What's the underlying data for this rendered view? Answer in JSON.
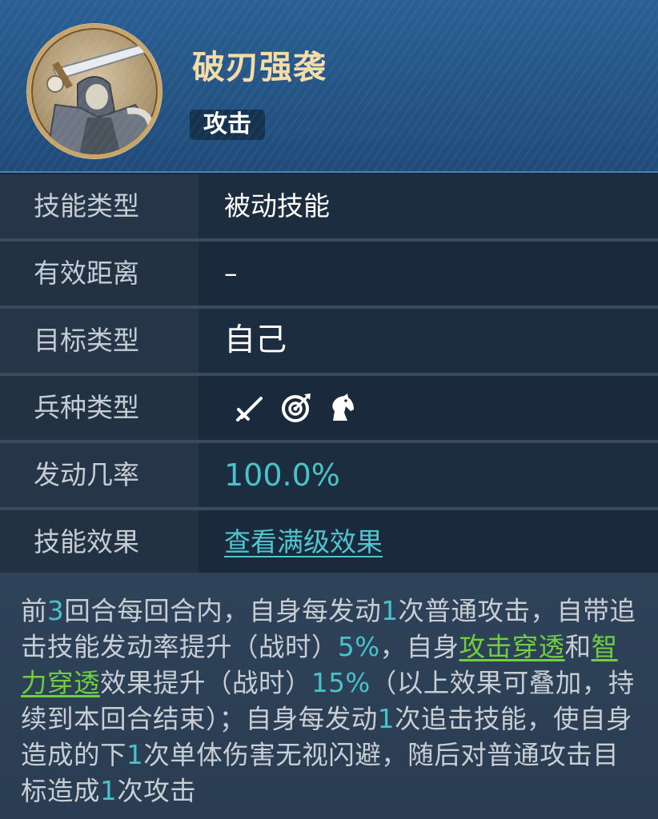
{
  "skill": {
    "name": "破刃强袭",
    "tag": "攻击"
  },
  "rows": [
    {
      "label": "技能类型",
      "value": "被动技能"
    },
    {
      "label": "有效距离",
      "value": "–"
    },
    {
      "label": "目标类型",
      "value": "自己"
    },
    {
      "label": "兵种类型",
      "icons": [
        "sword-icon",
        "target-icon",
        "horse-icon"
      ]
    },
    {
      "label": "发动几率",
      "value": "100.0%"
    },
    {
      "label": "技能效果",
      "value": "查看满级效果"
    }
  ],
  "description": {
    "p01": "前",
    "p02": "3",
    "p03": "回合每回合内，自身每发动",
    "p04": "1",
    "p05": "次普通攻击，自带追击技能发动率提升（战时）",
    "p06": "5%",
    "p07": "，自身",
    "p08": "攻击穿透",
    "p09": "和",
    "p10": "智力穿透",
    "p11": "效果提升（战时）",
    "p12": "15%",
    "p13": "（以上效果可叠加，持续到本回合结束）；自身每发动",
    "p14": "1",
    "p15": "次追击技能，使自身造成的下",
    "p16": "1",
    "p17": "次单体伤害无视闪避，随后对普通攻击目标造成",
    "p18": "1",
    "p19": "次攻击"
  },
  "colors": {
    "title": "#f3dca5",
    "accent_number": "#49c2c9",
    "keyword": "#6fcf3f",
    "header_bg": "#2b5f95"
  }
}
